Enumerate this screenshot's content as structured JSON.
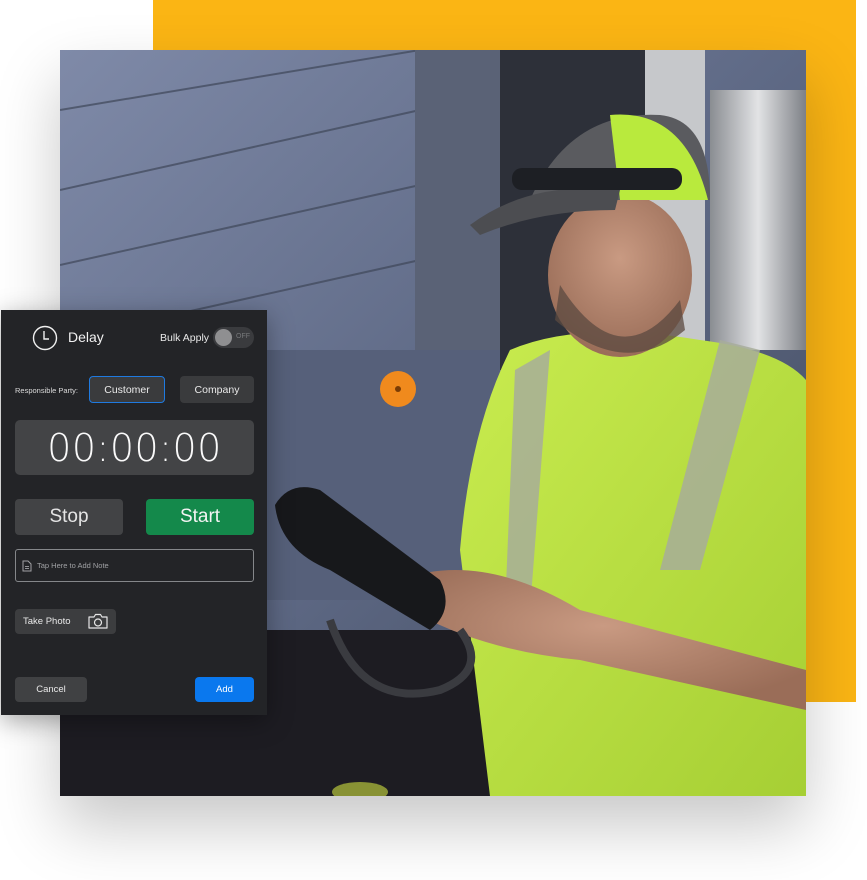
{
  "colors": {
    "accent_yellow": "#fbb514",
    "panel_bg": "#232427",
    "start_green": "#14894b",
    "add_blue": "#0a78ee",
    "selected_border": "#1f7ae0"
  },
  "photo": {
    "description": "Worker in hi-vis yellow-green shirt and cap holding a rugged tablet beside a truck"
  },
  "panel": {
    "title": "Delay",
    "title_icon": "clock-icon",
    "bulk_apply": {
      "label": "Bulk Apply",
      "state": "OFF",
      "on": false
    },
    "responsible_party": {
      "label": "Responsible Party:",
      "options": [
        "Customer",
        "Company"
      ],
      "selected": "Customer"
    },
    "timer": "00:00:00",
    "stop_label": "Stop",
    "start_label": "Start",
    "note": {
      "placeholder": "Tap Here to Add Note",
      "value": "",
      "icon": "document-icon"
    },
    "take_photo": {
      "label": "Take Photo",
      "icon": "camera-icon"
    },
    "cancel_label": "Cancel",
    "add_label": "Add"
  }
}
